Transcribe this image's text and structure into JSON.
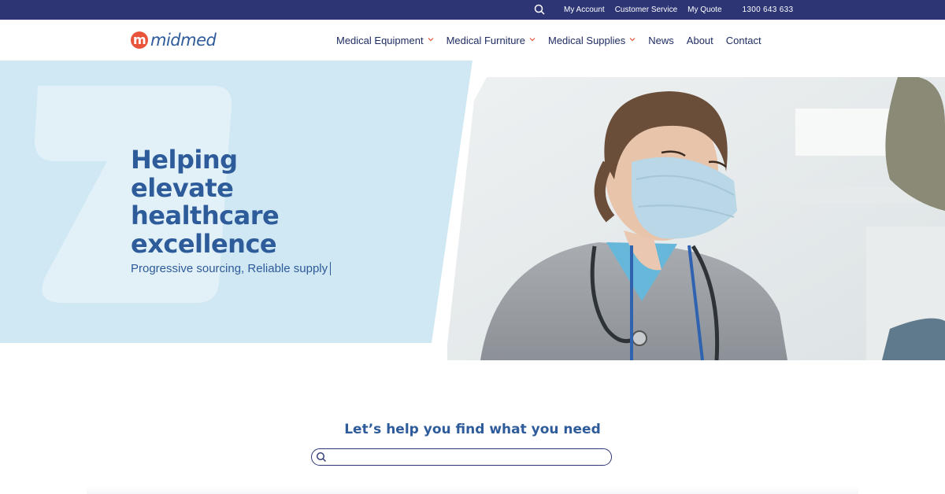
{
  "topbar": {
    "search_icon": "search-icon",
    "links": [
      "My Account",
      "Customer Service",
      "My Quote"
    ],
    "phone": "1300 643 633"
  },
  "logo": {
    "text": "midmed",
    "color": "#2e5b9a",
    "mark_color": "#e8533a"
  },
  "nav": {
    "items": [
      {
        "label": "Medical Equipment",
        "dropdown": true
      },
      {
        "label": "Medical Furniture",
        "dropdown": true
      },
      {
        "label": "Medical Supplies",
        "dropdown": true
      },
      {
        "label": "News",
        "dropdown": false
      },
      {
        "label": "About",
        "dropdown": false
      },
      {
        "label": "Contact",
        "dropdown": false
      }
    ]
  },
  "hero": {
    "title_lines": [
      "Helping",
      "elevate",
      "healthcare",
      "excellence"
    ],
    "subtitle": "Progressive sourcing, Reliable supply",
    "panel_color": "#cfe8f3"
  },
  "find": {
    "heading": "Let’s help you find what you need",
    "search_placeholder": ""
  },
  "colors": {
    "topbar": "#2d3575",
    "brand_blue": "#2e5b9a",
    "accent_red": "#e8533a"
  }
}
